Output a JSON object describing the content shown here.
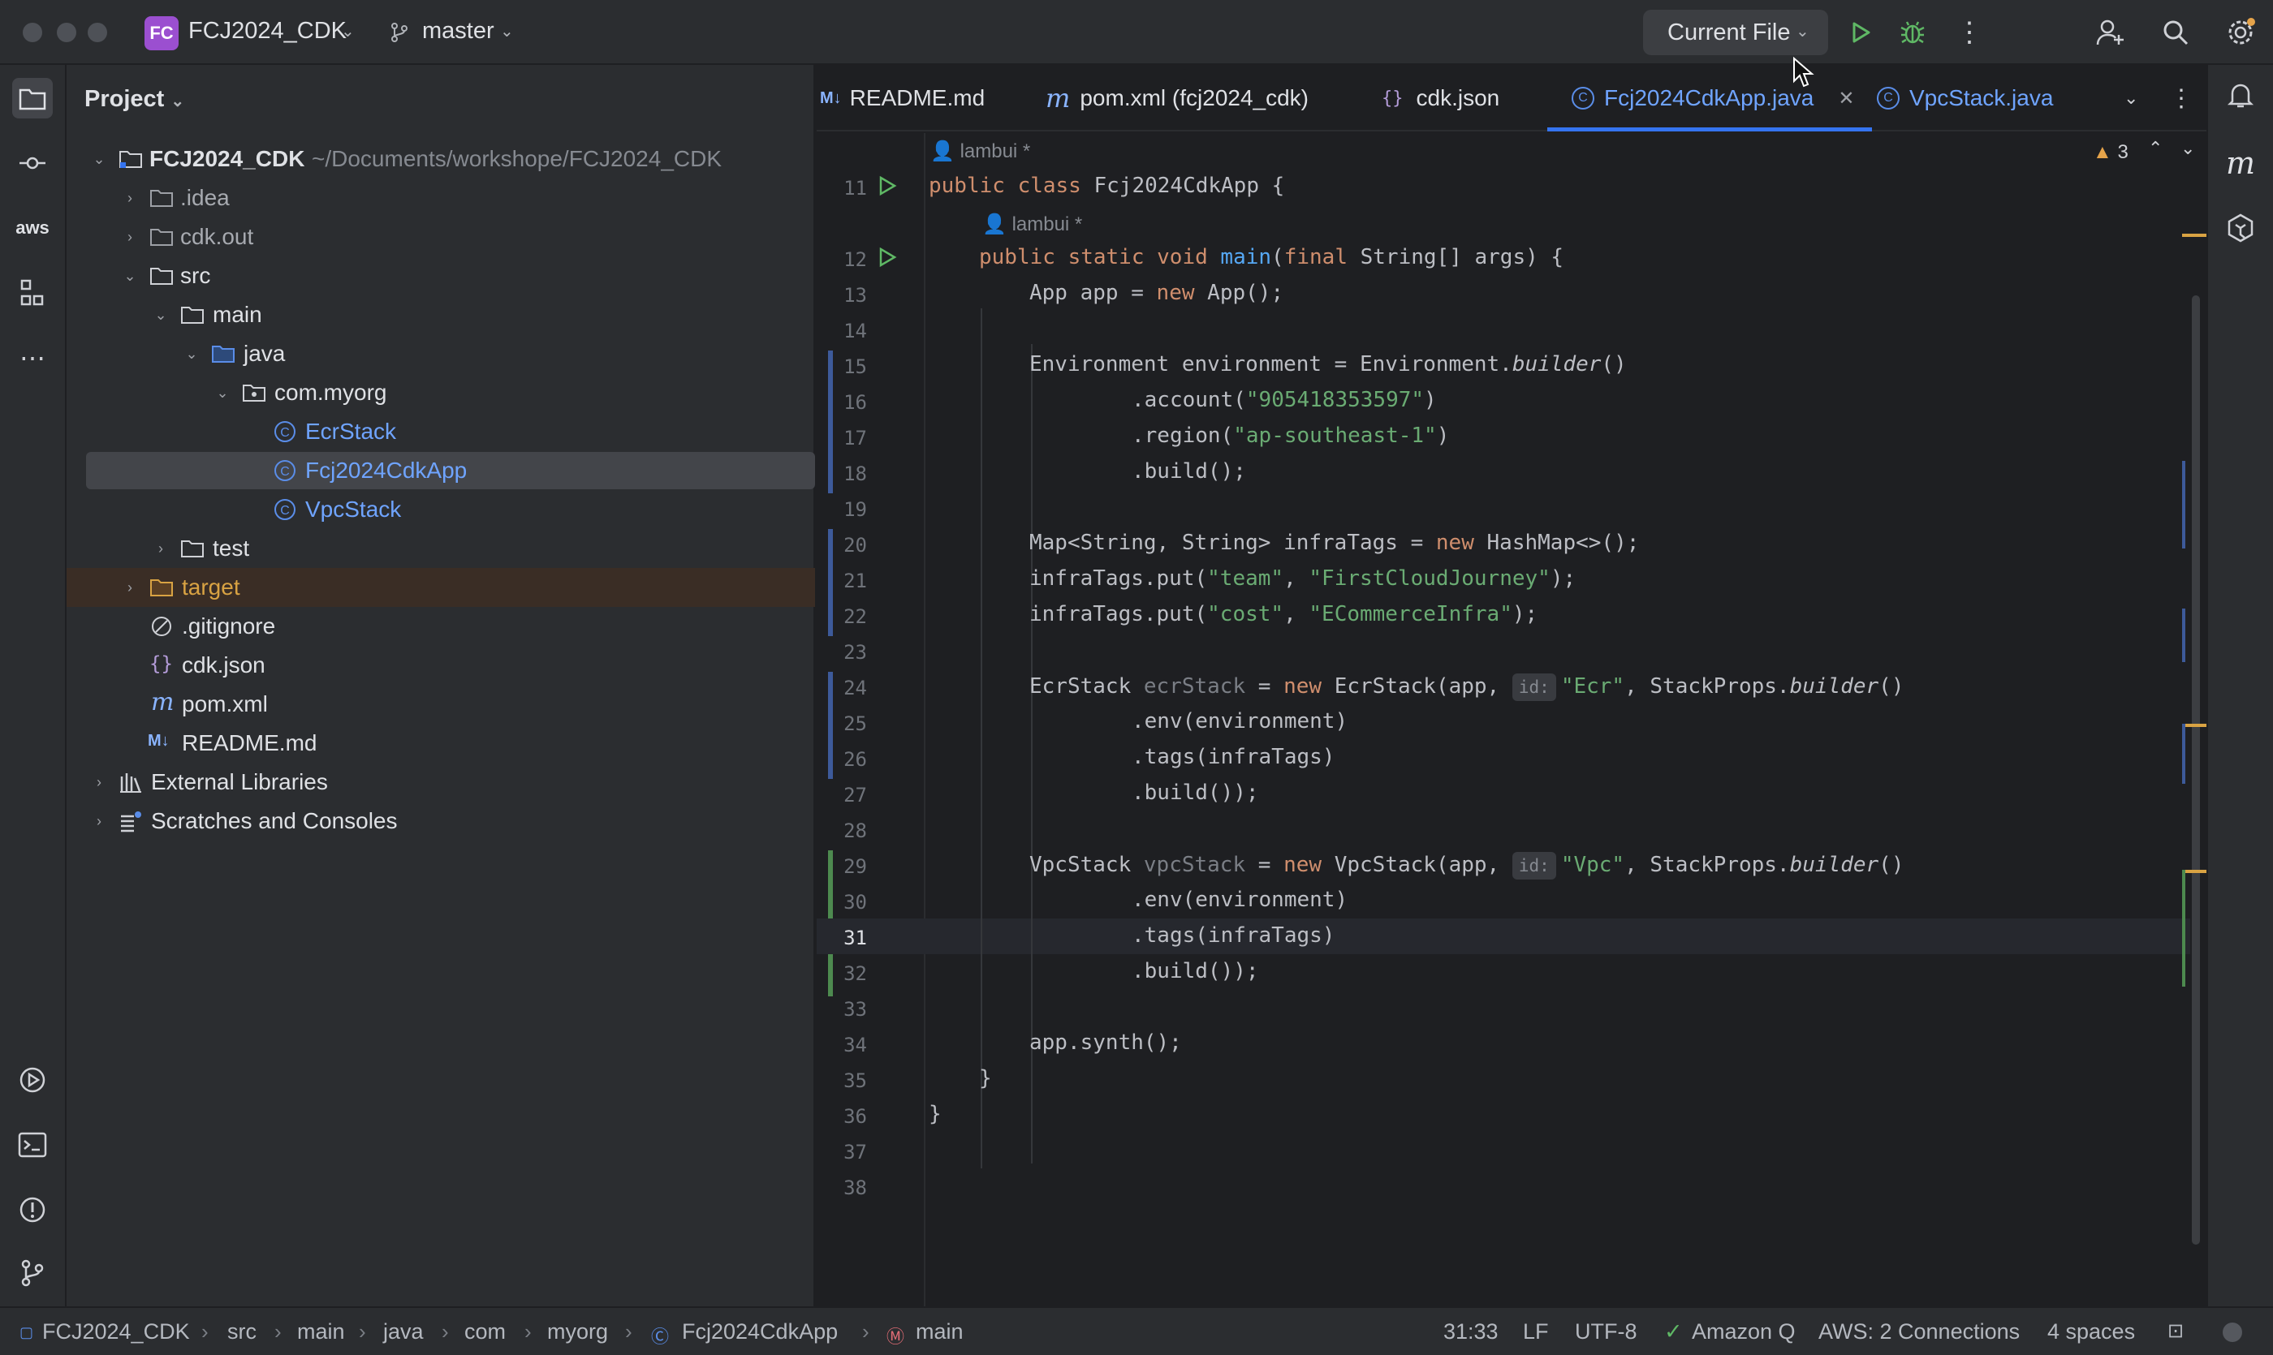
{
  "titlebar": {
    "project_badge": "FC",
    "project_name": "FCJ2024_CDK",
    "branch": "master",
    "run_config": "Current File"
  },
  "project_panel": {
    "title": "Project",
    "root_name": "FCJ2024_CDK",
    "root_path": "~/Documents/workshope/FCJ2024_CDK",
    "items": [
      {
        "label": ".idea"
      },
      {
        "label": "cdk.out"
      },
      {
        "label": "src"
      },
      {
        "label": "main"
      },
      {
        "label": "java"
      },
      {
        "label": "com.myorg"
      },
      {
        "label": "EcrStack"
      },
      {
        "label": "Fcj2024CdkApp"
      },
      {
        "label": "VpcStack"
      },
      {
        "label": "test"
      },
      {
        "label": "target"
      },
      {
        "label": ".gitignore"
      },
      {
        "label": "cdk.json"
      },
      {
        "label": "pom.xml"
      },
      {
        "label": "README.md"
      },
      {
        "label": "External Libraries"
      },
      {
        "label": "Scratches and Consoles"
      }
    ]
  },
  "tabs": [
    {
      "label": "README.md",
      "icon": "markdown-icon"
    },
    {
      "label": "pom.xml (fcj2024_cdk)",
      "icon": "maven-icon"
    },
    {
      "label": "cdk.json",
      "icon": "json-icon"
    },
    {
      "label": "Fcj2024CdkApp.java",
      "icon": "class-icon",
      "active": true
    },
    {
      "label": "VpcStack.java",
      "icon": "class-icon"
    }
  ],
  "editor": {
    "author1": "lambui *",
    "author2": "lambui *",
    "warnings_count": "3",
    "line_numbers": [
      "11",
      "12",
      "13",
      "14",
      "15",
      "16",
      "17",
      "18",
      "19",
      "20",
      "21",
      "22",
      "23",
      "24",
      "25",
      "26",
      "27",
      "28",
      "29",
      "30",
      "31",
      "32",
      "33",
      "34",
      "35",
      "36",
      "37",
      "38"
    ],
    "code": {
      "l11_kw": "public class ",
      "l11_rest": "Fcj2024CdkApp {",
      "l12_kw": "public static void ",
      "l12_fn": "main",
      "l12_p1": "(",
      "l12_kw2": "final ",
      "l12_rest": "String[] args) {",
      "l13_a": "App app = ",
      "l13_kw": "new ",
      "l13_b": "App();",
      "l15_a": "Environment environment = Environment.",
      "l15_it": "builder",
      "l15_b": "()",
      "l16_a": ".account(",
      "l16_s": "\"905418353597\"",
      "l16_b": ")",
      "l17_a": ".region(",
      "l17_s": "\"ap-southeast-1\"",
      "l17_b": ")",
      "l18": ".build();",
      "l20_a": "Map<String, String> infraTags = ",
      "l20_kw": "new ",
      "l20_b": "HashMap<>();",
      "l21_a": "infraTags.put(",
      "l21_s1": "\"team\"",
      "l21_c": ", ",
      "l21_s2": "\"FirstCloudJourney\"",
      "l21_b": ");",
      "l22_a": "infraTags.put(",
      "l22_s1": "\"cost\"",
      "l22_c": ", ",
      "l22_s2": "\"ECommerceInfra\"",
      "l22_b": ");",
      "l24_a": "EcrStack ",
      "l24_var": "ecrStack",
      "l24_b": " = ",
      "l24_kw": "new ",
      "l24_c": "EcrStack(app, ",
      "l24_hint": "id:",
      "l24_s": "\"Ecr\"",
      "l24_d": ", StackProps.",
      "l24_it": "builder",
      "l24_e": "()",
      "l25": ".env(environment)",
      "l26": ".tags(infraTags)",
      "l27": ".build());",
      "l29_a": "VpcStack ",
      "l29_var": "vpcStack",
      "l29_b": " = ",
      "l29_kw": "new ",
      "l29_c": "VpcStack(app, ",
      "l29_hint": "id:",
      "l29_s": "\"Vpc\"",
      "l29_d": ", StackProps.",
      "l29_it": "builder",
      "l29_e": "()",
      "l30": ".env(environment)",
      "l31": ".tags(infraTags)",
      "l32": ".build());",
      "l34": "app.synth();",
      "l35": "}",
      "l36": "}"
    }
  },
  "statusbar": {
    "crumbs": [
      "FCJ2024_CDK",
      "src",
      "main",
      "java",
      "com",
      "myorg",
      "Fcj2024CdkApp",
      "main"
    ],
    "position": "31:33",
    "line_sep": "LF",
    "encoding": "UTF-8",
    "amazon_q": "Amazon Q",
    "aws": "AWS: 2 Connections",
    "indent": "4 spaces"
  },
  "toolstrip": {
    "aws_label": "aws"
  },
  "rightstrip": {
    "maven_label": "m"
  },
  "colors": {
    "accent": "#3574f0",
    "run_green": "#5fb865",
    "string": "#6aab73",
    "keyword": "#cf8e6d",
    "folder_excluded": "#d9a343"
  }
}
